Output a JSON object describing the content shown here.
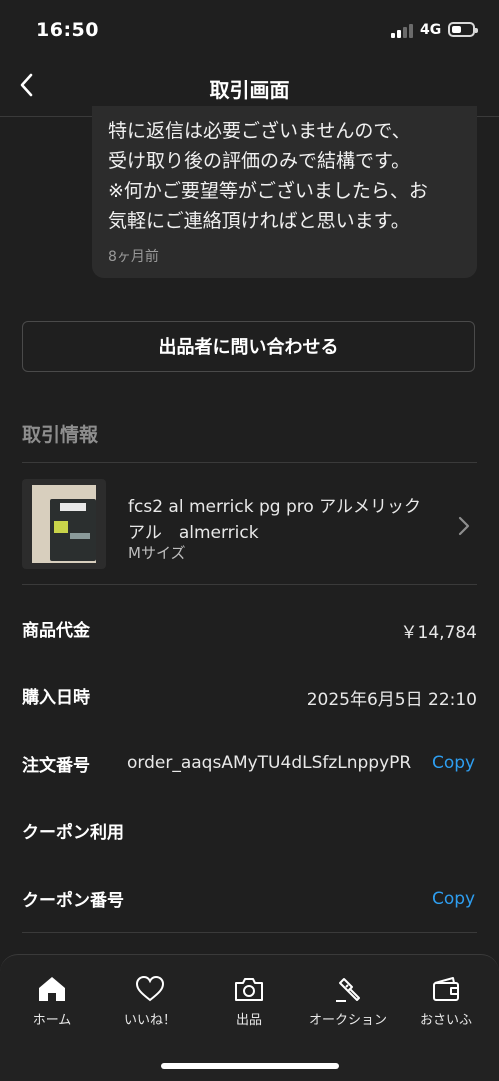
{
  "status_bar": {
    "time": "16:50",
    "network": "4G"
  },
  "nav": {
    "title": "取引画面"
  },
  "message": {
    "text": "特に返信は必要ございませんので、\n受け取り後の評価のみで結構です。\n※何かご要望等がございましたら、お\n気軽にご連絡頂ければと思います。",
    "timestamp": "8ヶ月前"
  },
  "contact_button": {
    "label": "出品者に問い合わせる"
  },
  "transaction_info": {
    "section_title": "取引情報",
    "item": {
      "title": "fcs2 al merrick pg pro アルメリック\nアル　almerrick",
      "size": "Mサイズ"
    },
    "rows": {
      "price_label": "商品代金",
      "price_value": "￥14,784",
      "date_label": "購入日時",
      "date_value": "2025年6月5日 22:10",
      "order_label": "注文番号",
      "order_value": "order_aaqsAMyTU4dLSfzLnppyPR",
      "order_copy": "Copy",
      "coupon_use_label": "クーポン利用",
      "coupon_no_label": "クーポン番号",
      "coupon_copy": "Copy"
    }
  },
  "tabbar": {
    "tabs": [
      {
        "label": "ホーム",
        "icon": "home-icon"
      },
      {
        "label": "いいね！",
        "icon": "heart-icon"
      },
      {
        "label": "出品",
        "icon": "camera-icon"
      },
      {
        "label": "オークション",
        "icon": "gavel-icon"
      },
      {
        "label": "おさいふ",
        "icon": "wallet-icon"
      }
    ]
  },
  "colors": {
    "background": "#1f1f1f",
    "accent": "#2e9ef0",
    "divider": "#3a3a3a"
  }
}
